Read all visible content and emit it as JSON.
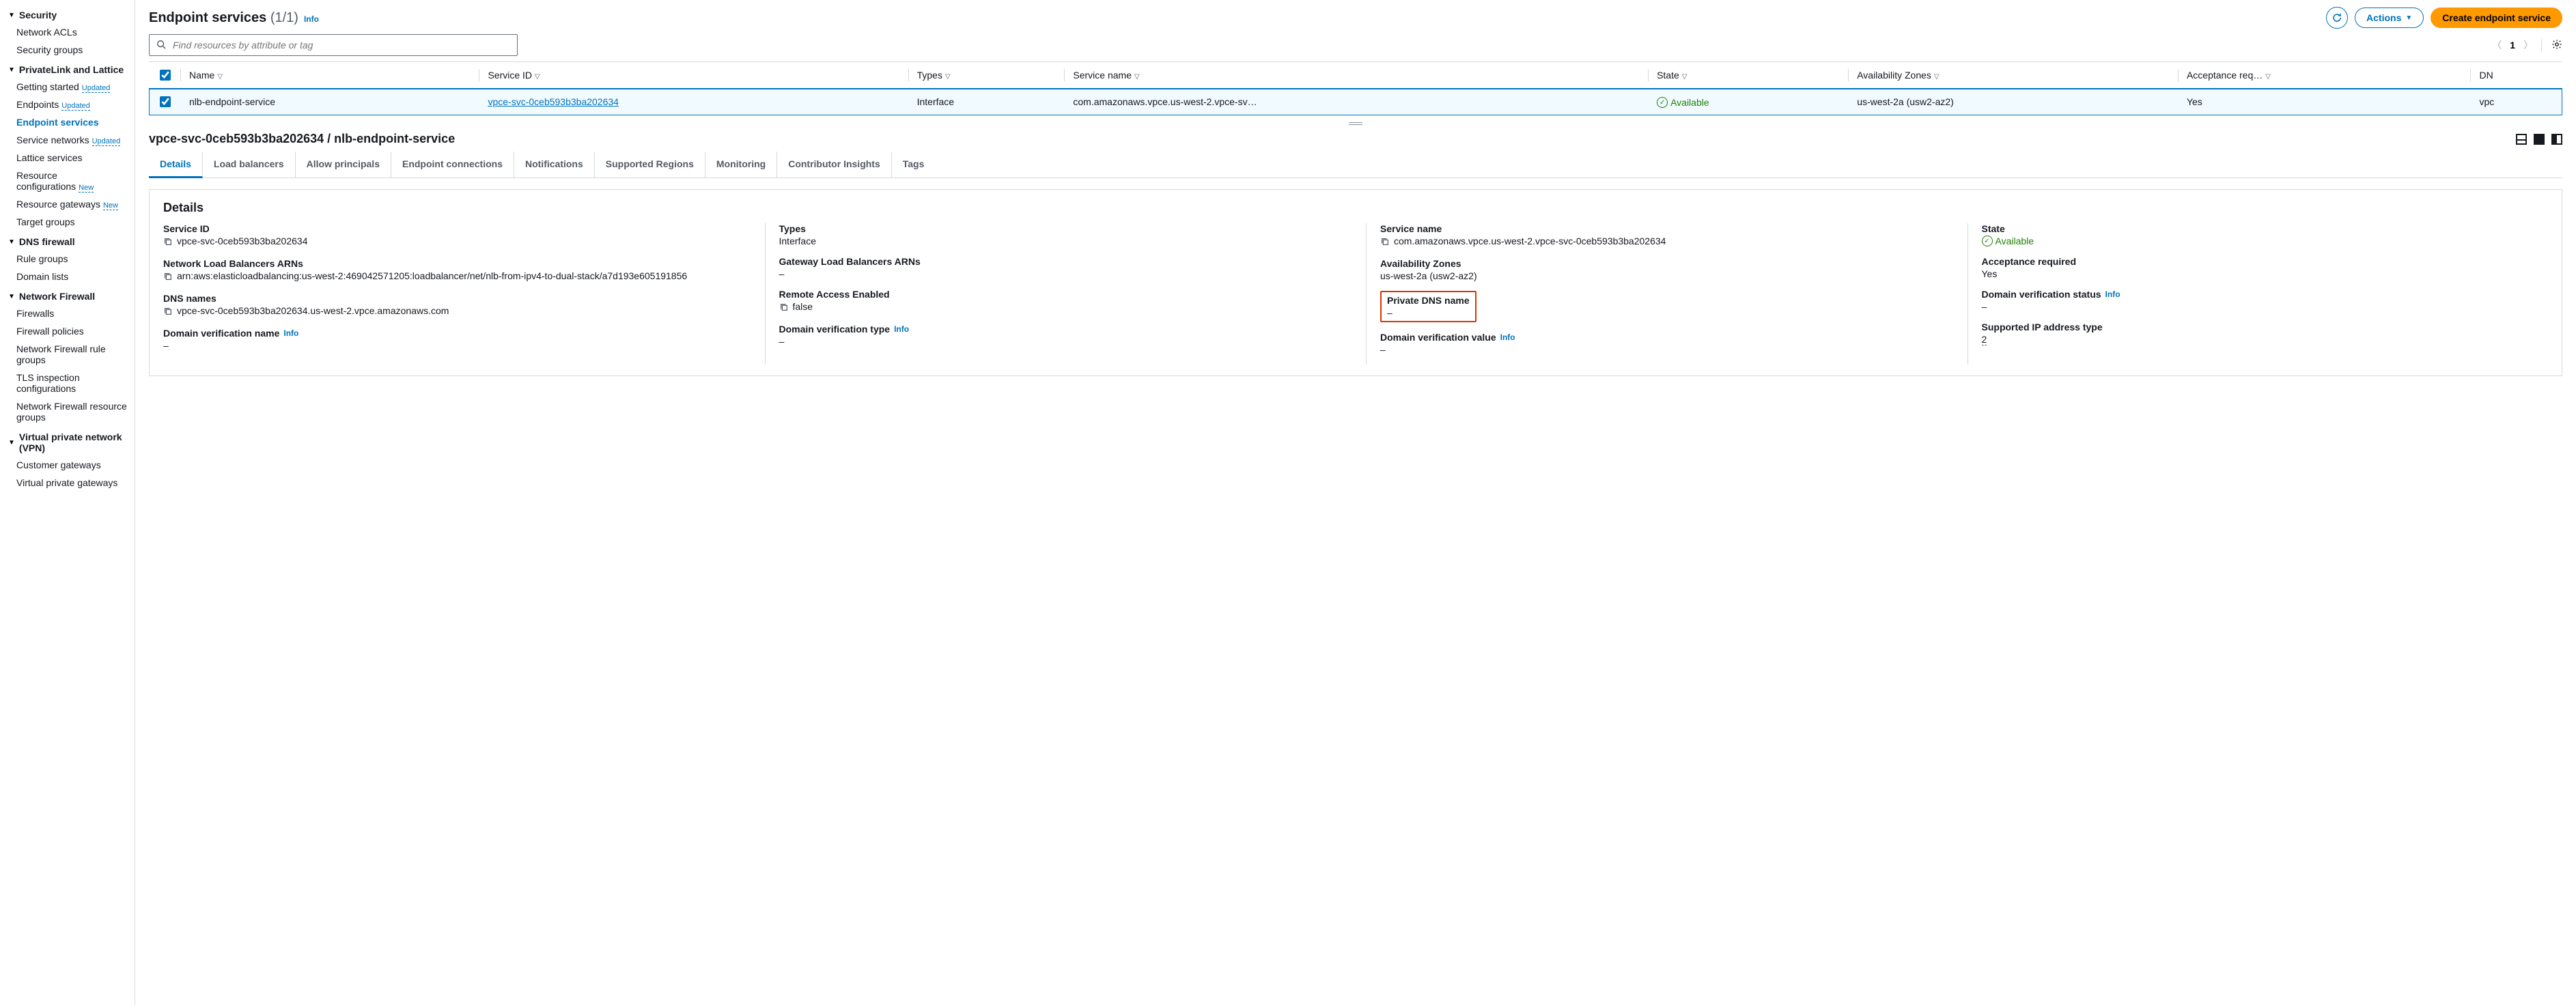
{
  "sidebar": {
    "groups": [
      {
        "label": "Security",
        "items": [
          {
            "label": "Network ACLs"
          },
          {
            "label": "Security groups"
          }
        ]
      },
      {
        "label": "PrivateLink and Lattice",
        "items": [
          {
            "label": "Getting started",
            "badge": "Updated"
          },
          {
            "label": "Endpoints",
            "badge": "Updated"
          },
          {
            "label": "Endpoint services",
            "active": true
          },
          {
            "label": "Service networks",
            "badge": "Updated"
          },
          {
            "label": "Lattice services"
          },
          {
            "label": "Resource configurations",
            "badge": "New"
          },
          {
            "label": "Resource gateways",
            "badge": "New"
          },
          {
            "label": "Target groups"
          }
        ]
      },
      {
        "label": "DNS firewall",
        "items": [
          {
            "label": "Rule groups"
          },
          {
            "label": "Domain lists"
          }
        ]
      },
      {
        "label": "Network Firewall",
        "items": [
          {
            "label": "Firewalls"
          },
          {
            "label": "Firewall policies"
          },
          {
            "label": "Network Firewall rule groups"
          },
          {
            "label": "TLS inspection configurations"
          },
          {
            "label": "Network Firewall resource groups"
          }
        ]
      },
      {
        "label": "Virtual private network (VPN)",
        "items": [
          {
            "label": "Customer gateways"
          },
          {
            "label": "Virtual private gateways"
          }
        ]
      }
    ]
  },
  "header": {
    "title": "Endpoint services",
    "count": "(1/1)",
    "info": "Info",
    "actions_label": "Actions",
    "create_label": "Create endpoint service"
  },
  "search": {
    "placeholder": "Find resources by attribute or tag"
  },
  "pager": {
    "page": "1"
  },
  "table": {
    "columns": [
      "Name",
      "Service ID",
      "Types",
      "Service name",
      "State",
      "Availability Zones",
      "Acceptance req…",
      "DN"
    ],
    "rows": [
      {
        "name": "nlb-endpoint-service",
        "service_id": "vpce-svc-0ceb593b3ba202634",
        "types": "Interface",
        "service_name": "com.amazonaws.vpce.us-west-2.vpce-sv…",
        "state": "Available",
        "azs": "us-west-2a (usw2-az2)",
        "acceptance": "Yes",
        "dns": "vpc"
      }
    ]
  },
  "detail": {
    "title": "vpce-svc-0ceb593b3ba202634 / nlb-endpoint-service",
    "tabs": [
      "Details",
      "Load balancers",
      "Allow principals",
      "Endpoint connections",
      "Notifications",
      "Supported Regions",
      "Monitoring",
      "Contributor Insights",
      "Tags"
    ],
    "panel_title": "Details",
    "info": "Info",
    "fields": {
      "service_id_label": "Service ID",
      "service_id": "vpce-svc-0ceb593b3ba202634",
      "nlb_arns_label": "Network Load Balancers ARNs",
      "nlb_arns": "arn:aws:elasticloadbalancing:us-west-2:469042571205:loadbalancer/net/nlb-from-ipv4-to-dual-stack/a7d193e605191856",
      "dns_names_label": "DNS names",
      "dns_names": "vpce-svc-0ceb593b3ba202634.us-west-2.vpce.amazonaws.com",
      "dvn_label": "Domain verification name",
      "dvn": "–",
      "types_label": "Types",
      "types": "Interface",
      "glb_arns_label": "Gateway Load Balancers ARNs",
      "glb_arns": "–",
      "rae_label": "Remote Access Enabled",
      "rae": "false",
      "dvt_label": "Domain verification type",
      "dvt": "–",
      "service_name_label": "Service name",
      "service_name": "com.amazonaws.vpce.us-west-2.vpce-svc-0ceb593b3ba202634",
      "azs_label": "Availability Zones",
      "azs": "us-west-2a (usw2-az2)",
      "pdn_label": "Private DNS name",
      "pdn": "–",
      "dvv_label": "Domain verification value",
      "dvv": "–",
      "state_label": "State",
      "state": "Available",
      "acc_req_label": "Acceptance required",
      "acc_req": "Yes",
      "dvs_label": "Domain verification status",
      "dvs": "–",
      "sip_label": "Supported IP address type",
      "sip": "2"
    }
  }
}
